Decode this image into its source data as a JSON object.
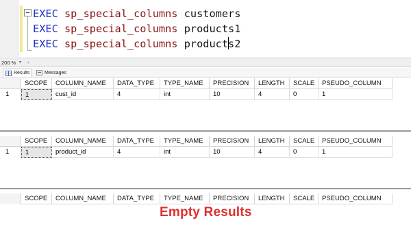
{
  "editor": {
    "lines": [
      {
        "keyword": "EXEC",
        "procedure": "sp_special_columns",
        "argument": "customers"
      },
      {
        "keyword": "EXEC",
        "procedure": "sp_special_columns",
        "argument": "products1"
      },
      {
        "keyword": "EXEC",
        "procedure": "sp_special_columns",
        "argument_before_caret": "product",
        "argument_after_caret": "s2"
      }
    ]
  },
  "zoom": {
    "value": "200 %",
    "arrow": "▾",
    "scroll": "‹"
  },
  "tabs": {
    "results": "Results",
    "messages": "Messages"
  },
  "columns": [
    "SCOPE",
    "COLUMN_NAME",
    "DATA_TYPE",
    "TYPE_NAME",
    "PRECISION",
    "LENGTH",
    "SCALE",
    "PSEUDO_COLUMN"
  ],
  "grids": [
    {
      "row_number": "1",
      "row": [
        "1",
        "cust_id",
        "4",
        "int",
        "10",
        "4",
        "0",
        "1"
      ]
    },
    {
      "row_number": "1",
      "row": [
        "1",
        "product_id",
        "4",
        "int",
        "10",
        "4",
        "0",
        "1"
      ]
    },
    {
      "empty_label": "Empty Results"
    }
  ],
  "colors": {
    "keyword": "#1f2fc4",
    "procedure": "#8b1010",
    "annotation": "#e03030"
  }
}
